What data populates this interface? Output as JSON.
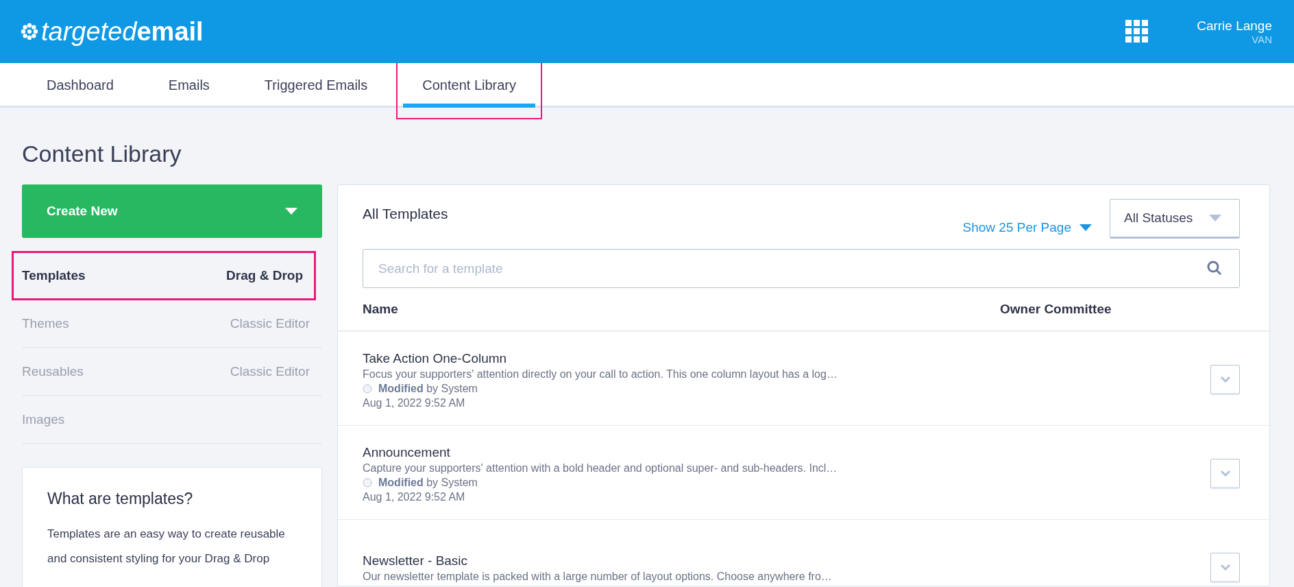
{
  "header": {
    "logo_light": "targeted",
    "logo_bold": "email",
    "user_name": "Carrie Lange",
    "user_org": "VAN"
  },
  "tabs": [
    {
      "label": "Dashboard",
      "selected": false,
      "highlighted": false
    },
    {
      "label": "Emails",
      "selected": false,
      "highlighted": false
    },
    {
      "label": "Triggered Emails",
      "selected": false,
      "highlighted": false
    },
    {
      "label": "Content Library",
      "selected": true,
      "highlighted": true
    }
  ],
  "page_title": "Content Library",
  "create_button": "Create New",
  "sidebar": {
    "items": [
      {
        "label": "Templates",
        "editor": "Drag & Drop",
        "selected": true,
        "highlighted": true
      },
      {
        "label": "Themes",
        "editor": "Classic Editor",
        "selected": false,
        "highlighted": false
      },
      {
        "label": "Reusables",
        "editor": "Classic Editor",
        "selected": false,
        "highlighted": false
      },
      {
        "label": "Images",
        "selected": false,
        "highlighted": false
      }
    ]
  },
  "help_card": {
    "title": "What are templates?",
    "text": "Templates are an easy way to create reusable and consistent styling for your Drag & Drop"
  },
  "panel": {
    "title": "All Templates",
    "per_page": "Show 25 Per Page",
    "status_filter": "All Statuses",
    "search": {
      "placeholder": "Search for a template"
    },
    "columns": [
      "Name",
      "Owner Committee"
    ],
    "rows": [
      {
        "name": "Take Action One-Column",
        "description": "Focus your supporters' attention directly on your call to action. This one column layout has a log…",
        "modified": "**Modified** by System",
        "date": "Aug 1, 2022 9:52 AM"
      },
      {
        "name": "Announcement",
        "description": "Capture your supporters' attention with a bold header and optional super- and sub-headers. Incl…",
        "modified": "**Modified** by System",
        "date": "Aug 1, 2022 9:52 AM"
      },
      {
        "name": "Newsletter - Basic",
        "description": "Our newsletter template is packed with a large number of layout options. Choose anywhere fro…"
      }
    ]
  }
}
